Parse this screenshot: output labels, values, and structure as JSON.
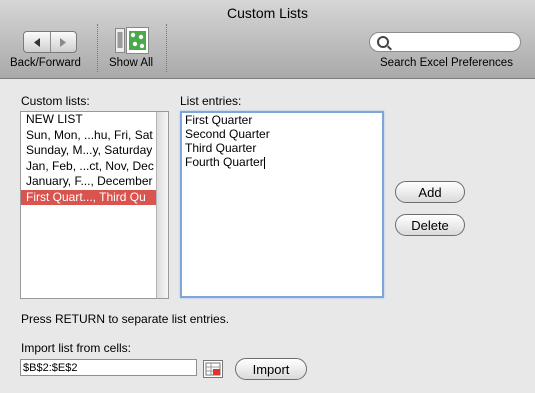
{
  "window": {
    "title": "Custom Lists"
  },
  "toolbar": {
    "back_forward_label": "Back/Forward",
    "show_all_label": "Show All",
    "search_label": "Search Excel Preferences",
    "search_value": "",
    "icons": {
      "back": "left-arrow-icon",
      "forward": "right-arrow-icon",
      "show_all": "show-all-icon",
      "search": "search-icon"
    }
  },
  "custom_lists": {
    "label": "Custom lists:",
    "items": [
      "NEW LIST",
      "Sun, Mon, ...hu, Fri, Sat",
      "Sunday, M...y, Saturday",
      "Jan, Feb, ...ct, Nov, Dec",
      "January, F..., December",
      "First Quart..., Third Qu"
    ],
    "selected_index": 5,
    "selected_color": "#d9534f"
  },
  "list_entries": {
    "label": "List entries:",
    "lines": [
      "First Quarter",
      "Second Quarter",
      "Third Quarter",
      "Fourth Quarter"
    ]
  },
  "buttons": {
    "add": "Add",
    "delete": "Delete",
    "import": "Import"
  },
  "hint": "Press RETURN to separate list entries.",
  "import_section": {
    "label": "Import list from cells:",
    "value": "$B$2:$E$2"
  }
}
